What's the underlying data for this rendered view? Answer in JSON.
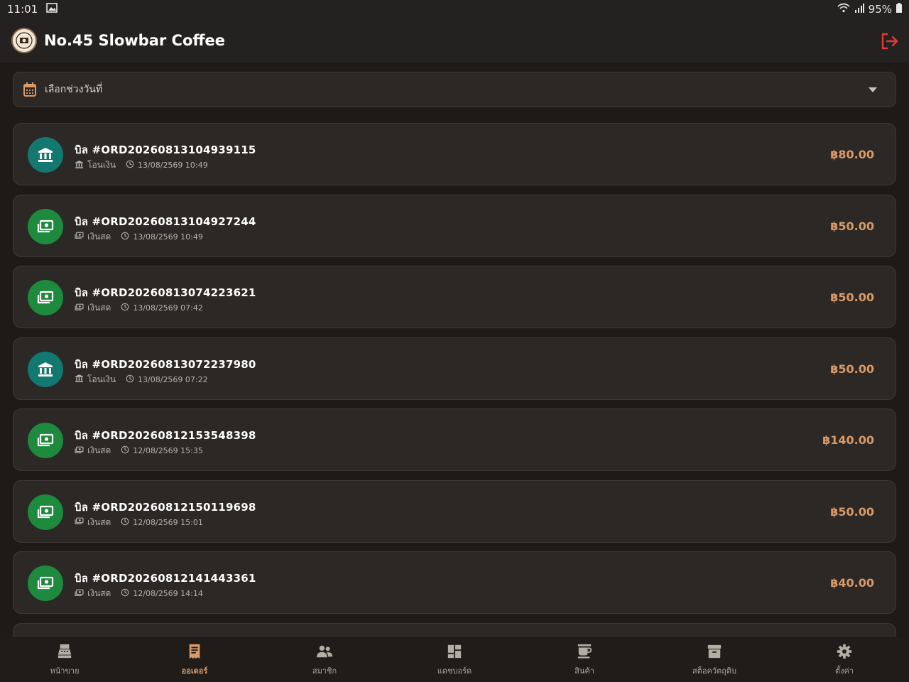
{
  "status_bar": {
    "time": "11:01",
    "battery": "95%"
  },
  "header": {
    "title": "No.45 Slowbar Coffee"
  },
  "date_filter": {
    "label": "เลือกช่วงวันที่"
  },
  "colors": {
    "accent": "#d99a68",
    "transfer_icon_bg": "#13786f",
    "cash_icon_bg": "#1e8a3e",
    "logout": "#e53935"
  },
  "orders": [
    {
      "title": "บิล #ORD20260813104939115",
      "method": "โอนเงิน",
      "method_icon": "bank-icon",
      "time": "13/08/2569 10:49",
      "amount": "฿80.00"
    },
    {
      "title": "บิล #ORD20260813104927244",
      "method": "เงินสด",
      "method_icon": "cash-icon",
      "time": "13/08/2569 10:49",
      "amount": "฿50.00"
    },
    {
      "title": "บิล #ORD20260813074223621",
      "method": "เงินสด",
      "method_icon": "cash-icon",
      "time": "13/08/2569 07:42",
      "amount": "฿50.00"
    },
    {
      "title": "บิล #ORD20260813072237980",
      "method": "โอนเงิน",
      "method_icon": "bank-icon",
      "time": "13/08/2569 07:22",
      "amount": "฿50.00"
    },
    {
      "title": "บิล #ORD20260812153548398",
      "method": "เงินสด",
      "method_icon": "cash-icon",
      "time": "12/08/2569 15:35",
      "amount": "฿140.00"
    },
    {
      "title": "บิล #ORD20260812150119698",
      "method": "เงินสด",
      "method_icon": "cash-icon",
      "time": "12/08/2569 15:01",
      "amount": "฿50.00"
    },
    {
      "title": "บิล #ORD20260812141443361",
      "method": "เงินสด",
      "method_icon": "cash-icon",
      "time": "12/08/2569 14:14",
      "amount": "฿40.00"
    }
  ],
  "nav": [
    {
      "label": "หน้าขาย",
      "icon": "cash-register-icon",
      "active": false
    },
    {
      "label": "ออเดอร์",
      "icon": "receipt-icon",
      "active": true
    },
    {
      "label": "สมาชิก",
      "icon": "people-icon",
      "active": false
    },
    {
      "label": "แดชบอร์ด",
      "icon": "dashboard-icon",
      "active": false
    },
    {
      "label": "สินค้า",
      "icon": "coffee-icon",
      "active": false
    },
    {
      "label": "สต็อควัตถุดิบ",
      "icon": "inventory-icon",
      "active": false
    },
    {
      "label": "ตั้งค่า",
      "icon": "gear-icon",
      "active": false
    }
  ]
}
